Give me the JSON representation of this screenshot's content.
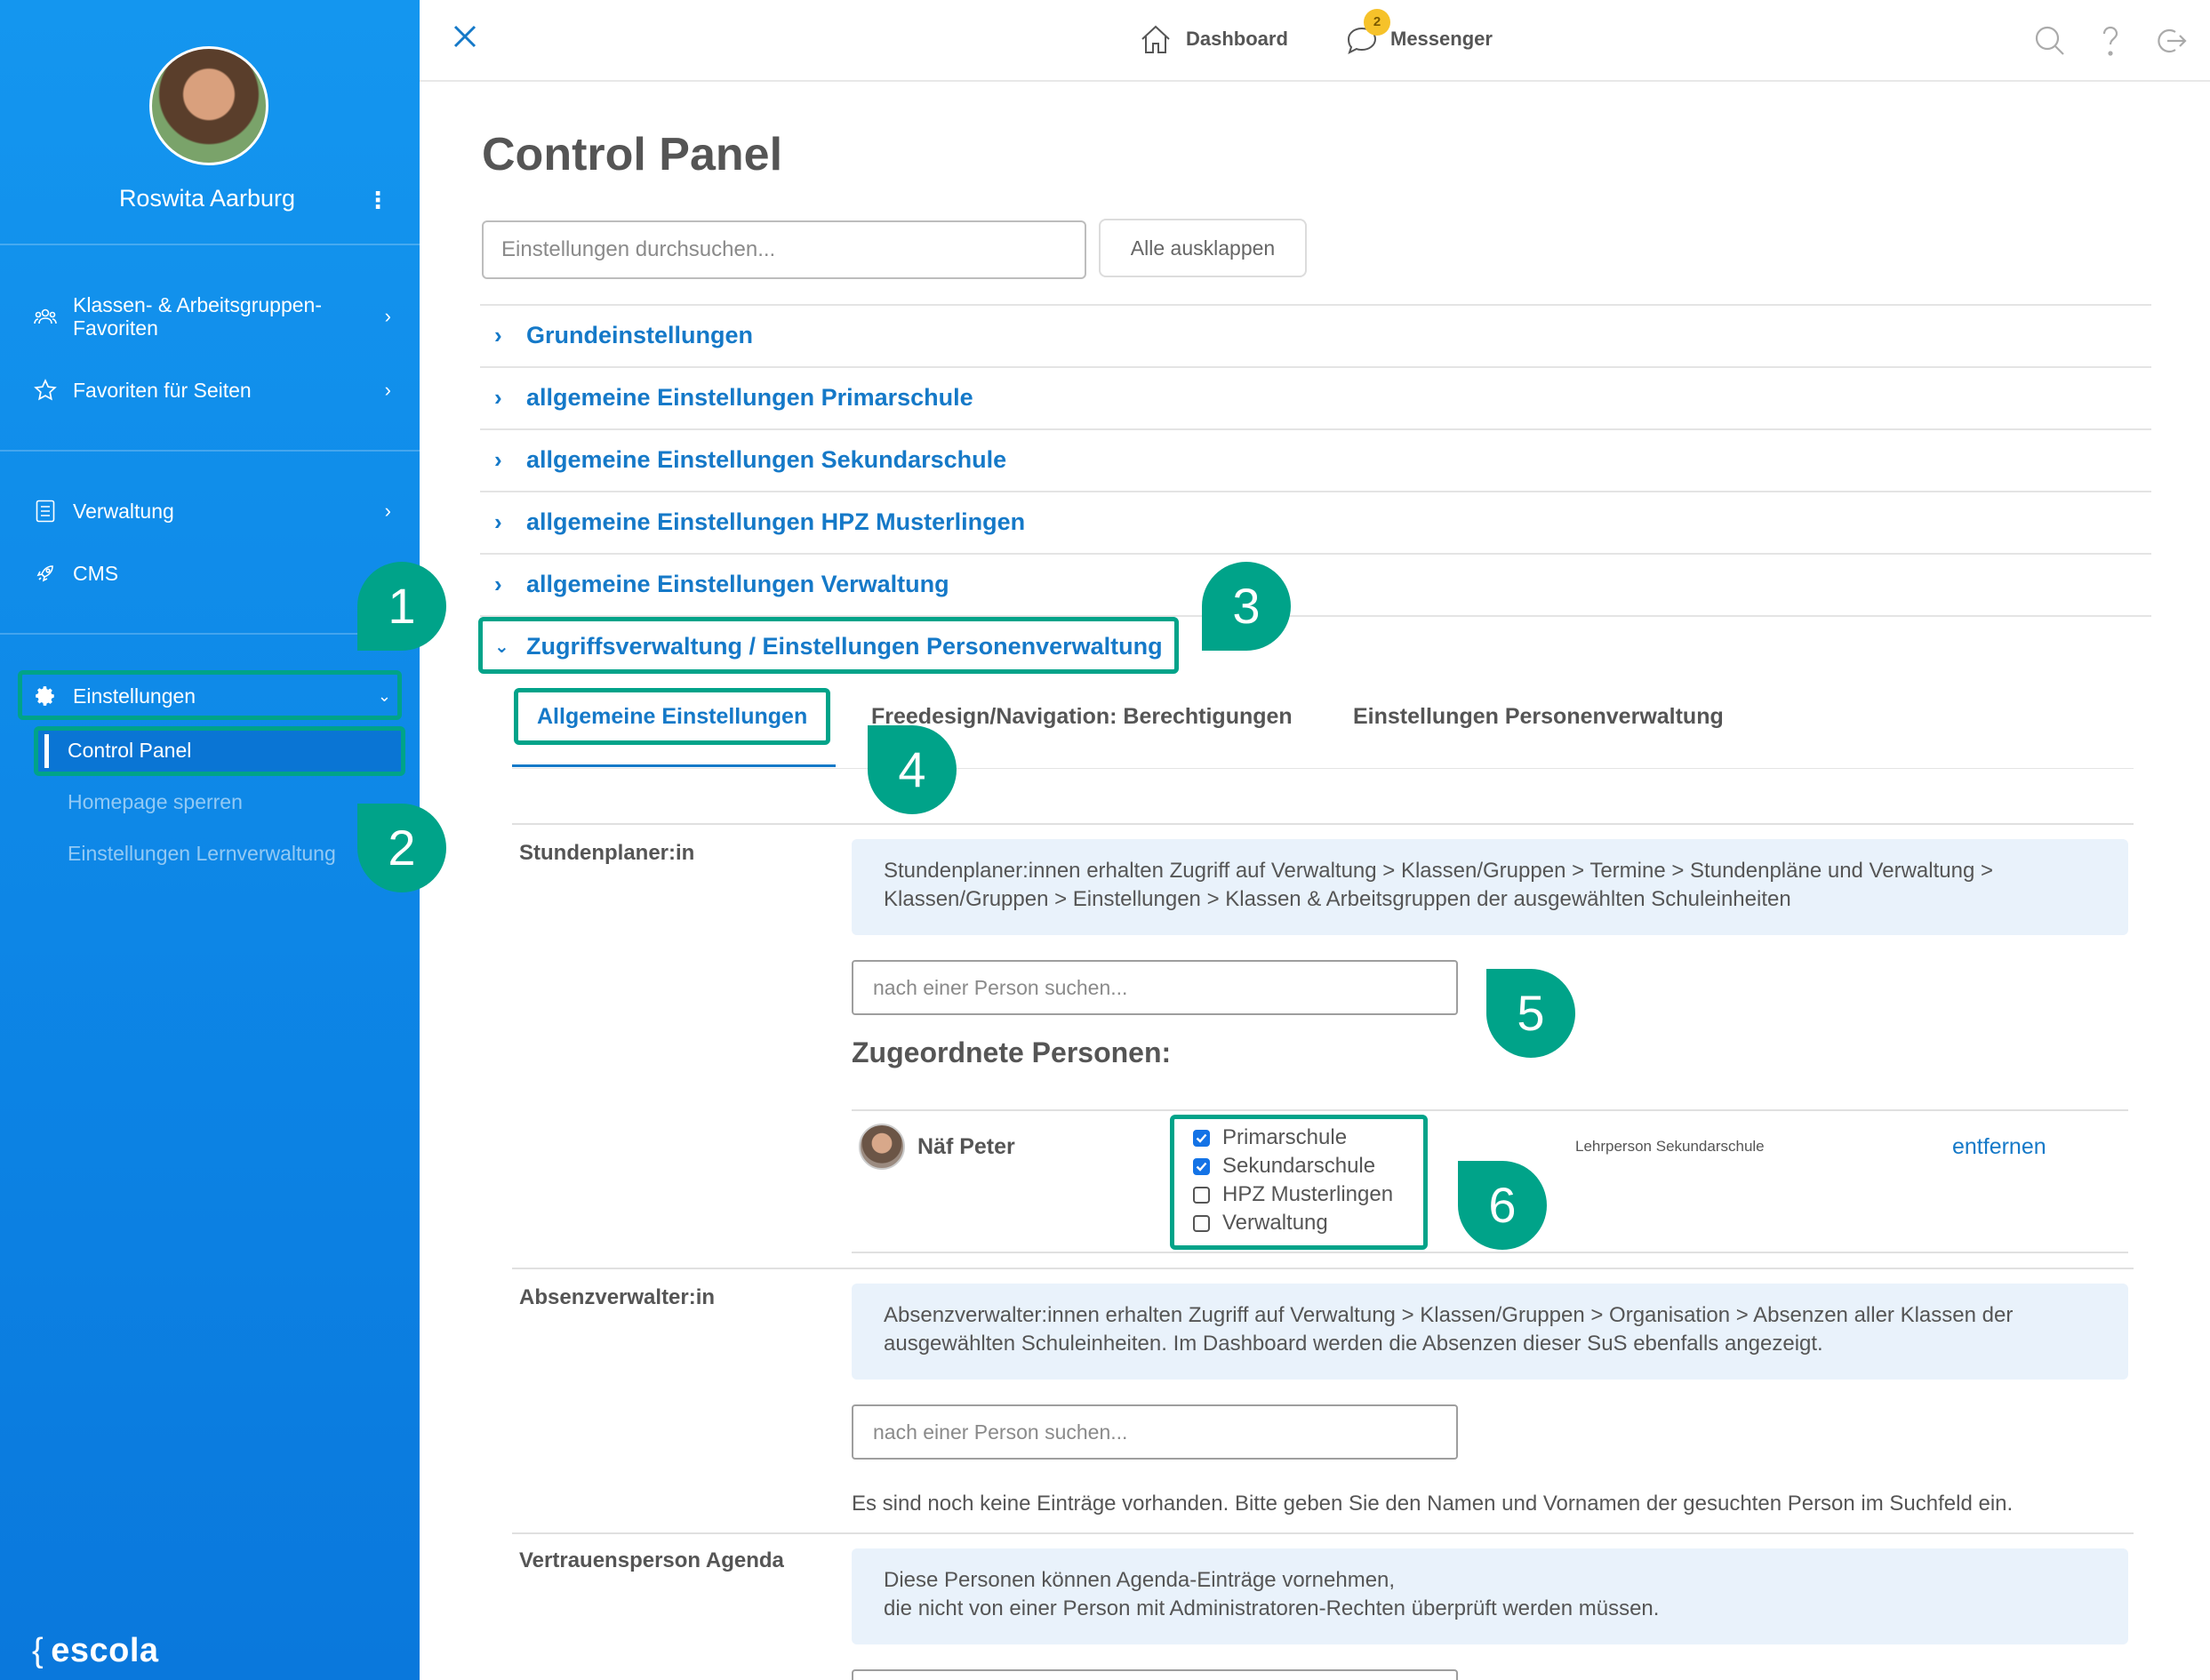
{
  "sidebar": {
    "user_name": "Roswita Aarburg",
    "menu_glyph": "⋮",
    "items": [
      {
        "label": "Klassen- & Arbeitsgruppen-\nFavoriten",
        "icon": "group-icon"
      },
      {
        "label": "Favoriten für Seiten",
        "icon": "star-icon"
      },
      {
        "label": "Verwaltung",
        "icon": "clipboard-icon"
      },
      {
        "label": "CMS",
        "icon": "rocket-icon"
      },
      {
        "label": "Einstellungen",
        "icon": "gear-icon"
      }
    ],
    "sub_items": [
      "Control Panel",
      "Homepage sperren",
      "Einstellungen Lernverwaltung"
    ],
    "logo": "escola",
    "logo_brace": "{"
  },
  "topbar": {
    "dashboard": "Dashboard",
    "messenger": "Messenger",
    "messenger_badge": "2"
  },
  "main": {
    "title": "Control Panel",
    "search_placeholder": "Einstellungen durchsuchen...",
    "expand_all": "Alle ausklappen",
    "accordion": [
      "Grundeinstellungen",
      "allgemeine Einstellungen Primarschule",
      "allgemeine Einstellungen Sekundarschule",
      "allgemeine Einstellungen HPZ Musterlingen",
      "allgemeine Einstellungen Verwaltung",
      "Zugriffsverwaltung / Einstellungen Personenverwaltung"
    ],
    "tabs": [
      "Allgemeine Einstellungen",
      "Freedesign/Navigation: Berechtigungen",
      "Einstellungen Personenverwaltung"
    ],
    "sections": [
      {
        "label": "Stundenplaner:in",
        "info": "Stundenplaner:innen erhalten Zugriff auf Verwaltung > Klassen/Gruppen > Termine > Stundenpläne und Verwaltung > Klassen/Gruppen > Einstellungen > Klassen & Arbeitsgruppen der ausgewählten Schuleinheiten",
        "search_placeholder": "nach einer Person suchen...",
        "assigned_title": "Zugeordnete Personen:",
        "person": {
          "name": "Näf Peter",
          "role": "Lehrperson Sekundarschule",
          "remove": "entfernen",
          "units": [
            {
              "label": "Primarschule",
              "checked": true
            },
            {
              "label": "Sekundarschule",
              "checked": true
            },
            {
              "label": "HPZ Musterlingen",
              "checked": false
            },
            {
              "label": "Verwaltung",
              "checked": false
            }
          ]
        }
      },
      {
        "label": "Absenzverwalter:in",
        "info": "Absenzverwalter:innen erhalten Zugriff auf Verwaltung > Klassen/Gruppen > Organisation > Absenzen aller Klassen der ausgewählten Schuleinheiten. Im Dashboard werden die Absenzen dieser SuS ebenfalls angezeigt.",
        "search_placeholder": "nach einer Person suchen...",
        "empty_text": "Es sind noch keine Einträge vorhanden. Bitte geben Sie den Namen und Vornamen der gesuchten Person im Suchfeld ein."
      },
      {
        "label": "Vertrauensperson Agenda",
        "info": "Diese Personen können Agenda-Einträge vornehmen,\ndie nicht von einer Person mit Administratoren-Rechten überprüft werden müssen."
      }
    ]
  },
  "callouts": [
    "1",
    "2",
    "3",
    "4",
    "5",
    "6"
  ],
  "colors": {
    "sidebar": "#0d86e6",
    "accent": "#1579c8",
    "callout": "#00a389",
    "badge": "#f6c22a",
    "info_bg": "#e9f2fb"
  }
}
